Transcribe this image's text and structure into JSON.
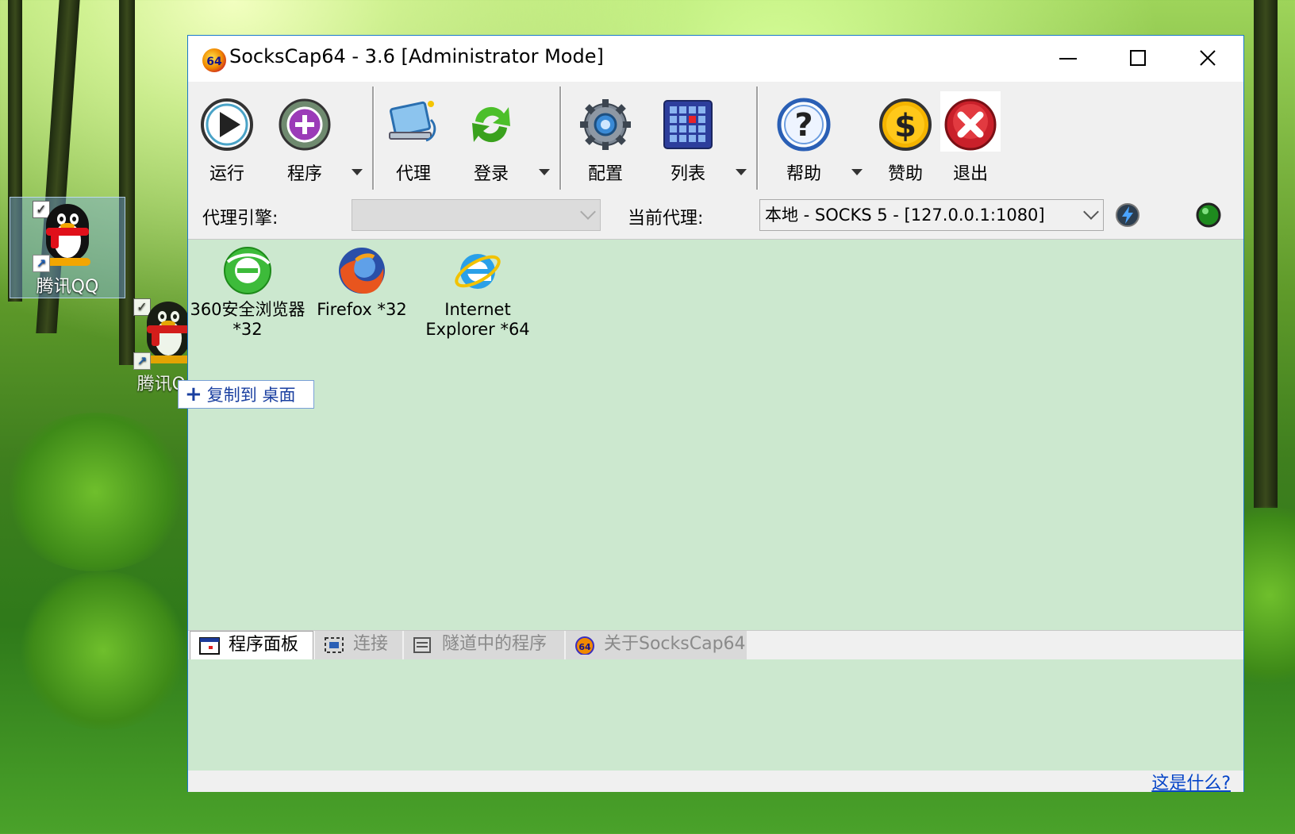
{
  "desktop": {
    "icon1_label": "腾讯QQ",
    "icon2_label": "腾讯QQ",
    "drag_tooltip": "复制到 桌面"
  },
  "window": {
    "title": "SocksCap64 - 3.6 [Administrator Mode]",
    "logo_text": "64"
  },
  "toolbar": {
    "run": "运行",
    "programs": "程序",
    "proxy": "代理",
    "login": "登录",
    "config": "配置",
    "list": "列表",
    "help": "帮助",
    "sponsor": "赞助",
    "exit": "退出"
  },
  "proxybar": {
    "engine_label": "代理引擎:",
    "engine_value": "",
    "current_label": "当前代理:",
    "current_value": "本地 - SOCKS 5 - [127.0.0.1:1080]"
  },
  "apps": [
    {
      "label": "360安全浏览器 *32"
    },
    {
      "label": "Firefox *32"
    },
    {
      "label": "Internet Explorer *64"
    }
  ],
  "tabs": {
    "programs": "程序面板",
    "connections": "连接",
    "tunneled": "隧道中的程序",
    "about": "关于SocksCap64"
  },
  "status": {
    "help_link": "这是什么?"
  },
  "colors": {
    "content_bg": "#cce8cf",
    "link": "#0645c8",
    "window_border": "#1979ca"
  }
}
